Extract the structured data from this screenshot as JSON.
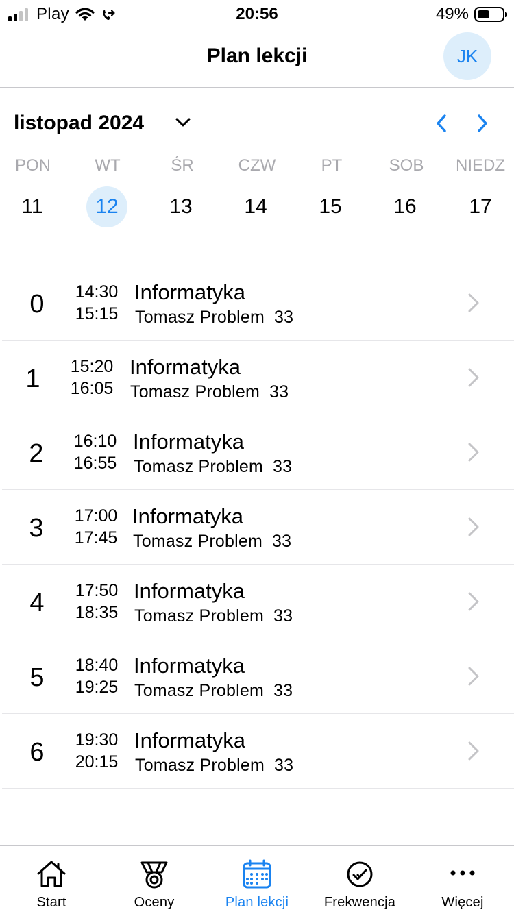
{
  "status_bar": {
    "carrier": "Play",
    "time": "20:56",
    "battery": "49%",
    "battery_level": 0.49
  },
  "header": {
    "title": "Plan lekcji",
    "avatar_initials": "JK"
  },
  "calendar": {
    "month_label": "listopad 2024",
    "weekdays": [
      "PON",
      "WT",
      "ŚR",
      "CZW",
      "PT",
      "SOB",
      "NIEDZ"
    ],
    "days": [
      "11",
      "12",
      "13",
      "14",
      "15",
      "16",
      "17"
    ],
    "selected_day": "12"
  },
  "lessons": [
    {
      "number": "0",
      "start": "14:30",
      "end": "15:15",
      "subject": "Informatyka",
      "teacher": "Tomasz Problem",
      "room": "33"
    },
    {
      "number": "1",
      "start": "15:20",
      "end": "16:05",
      "subject": "Informatyka",
      "teacher": "Tomasz Problem",
      "room": "33"
    },
    {
      "number": "2",
      "start": "16:10",
      "end": "16:55",
      "subject": "Informatyka",
      "teacher": "Tomasz Problem",
      "room": "33"
    },
    {
      "number": "3",
      "start": "17:00",
      "end": "17:45",
      "subject": "Informatyka",
      "teacher": "Tomasz Problem",
      "room": "33"
    },
    {
      "number": "4",
      "start": "17:50",
      "end": "18:35",
      "subject": "Informatyka",
      "teacher": "Tomasz Problem",
      "room": "33"
    },
    {
      "number": "5",
      "start": "18:40",
      "end": "19:25",
      "subject": "Informatyka",
      "teacher": "Tomasz Problem",
      "room": "33"
    },
    {
      "number": "6",
      "start": "19:30",
      "end": "20:15",
      "subject": "Informatyka",
      "teacher": "Tomasz Problem",
      "room": "33"
    }
  ],
  "tabbar": {
    "tabs": [
      {
        "label": "Start",
        "icon": "home-icon"
      },
      {
        "label": "Oceny",
        "icon": "medal-icon"
      },
      {
        "label": "Plan lekcji",
        "icon": "calendar-icon"
      },
      {
        "label": "Frekwencja",
        "icon": "checkmark-circle-icon"
      },
      {
        "label": "Więcej",
        "icon": "more-icon"
      }
    ],
    "active": "Plan lekcji"
  },
  "colors": {
    "accent": "#1a83f0",
    "accent_light": "#ddeefb",
    "muted": "#a9a9ae",
    "chevron": "#c4c4c7"
  }
}
